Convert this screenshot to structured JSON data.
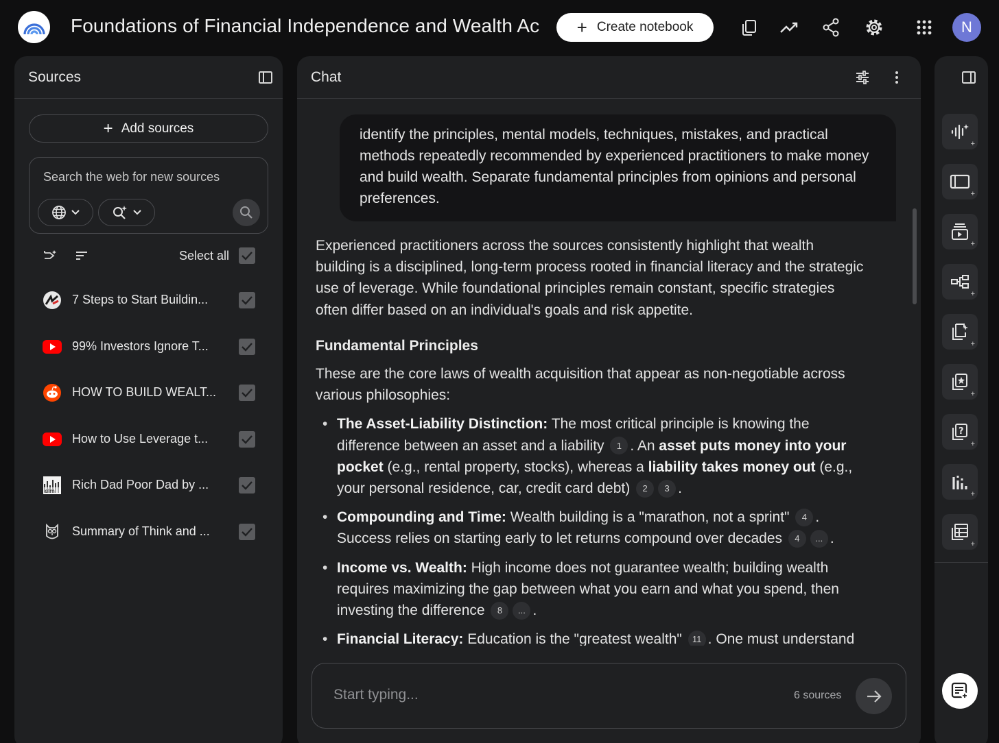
{
  "header": {
    "title": "Foundations of Financial Independence and Wealth Acquisition",
    "create_label": "Create notebook",
    "avatar_initial": "N"
  },
  "sources": {
    "title": "Sources",
    "add_label": "Add sources",
    "search_placeholder": "Search the web for new sources",
    "select_all_label": "Select all",
    "items": [
      {
        "label": "7 Steps to Start Buildin...",
        "icon": "brand-icon"
      },
      {
        "label": "99% Investors Ignore T...",
        "icon": "youtube-icon"
      },
      {
        "label": "HOW TO BUILD WEALT...",
        "icon": "reddit-icon"
      },
      {
        "label": "How to Use Leverage t...",
        "icon": "youtube-icon"
      },
      {
        "label": "Rich Dad Poor Dad by ...",
        "icon": "book-thumbnail-icon"
      },
      {
        "label": "Summary of Think and ...",
        "icon": "owl-icon"
      }
    ]
  },
  "chat": {
    "title": "Chat",
    "user_message": "identify the principles, mental models, techniques, mistakes, and practical methods repeatedly recommended by experienced practitioners to make money and build wealth. Separate fundamental principles from opinions and personal preferences.",
    "intro": "Experienced practitioners across the sources consistently highlight that wealth building is a disciplined, long-term process rooted in financial literacy and the strategic use of leverage. While foundational principles remain constant, specific strategies often differ based on an individual's goals and risk appetite.",
    "section_heading": "Fundamental Principles",
    "section_intro": "These are the core laws of wealth acquisition that appear as non-negotiable across various philosophies:",
    "bullets": {
      "b1": {
        "lead": "The Asset-Liability Distinction:",
        "t1": " The most critical principle is knowing the difference between an asset and a liability ",
        "c1": "1",
        "t2": ". An ",
        "bold2": "asset puts money into your pocket",
        "t3": " (e.g., rental property, stocks), whereas a ",
        "bold3": "liability takes money out",
        "t4": " (e.g., your personal residence, car, credit card debt) ",
        "c2": "2",
        "c3": "3",
        "t5": "."
      },
      "b2": {
        "lead": "Compounding and Time:",
        "t1": " Wealth building is a \"marathon, not a sprint\" ",
        "c1": "4",
        "t2": ". Success relies on starting early to let returns compound over decades ",
        "c2": "4",
        "c3": "...",
        "t3": "."
      },
      "b3": {
        "lead": "Income vs. Wealth:",
        "t1": " High income does not guarantee wealth; building wealth requires maximizing the gap between what you earn and what you spend, then investing the difference ",
        "c1": "8",
        "c2": "...",
        "t2": "."
      },
      "b4": {
        "lead": "Financial Literacy:",
        "t1": " Education is the \"greatest wealth\" ",
        "c1": "11",
        "t2": ". One must understand accounting, investing, markets, and law (specifically tax and corporate"
      }
    },
    "composer_placeholder": "Start typing...",
    "sources_count": "6 sources"
  },
  "studio": {
    "buttons": [
      "audio-overview-icon",
      "video-overview-icon",
      "slides-icon",
      "mind-map-icon",
      "reports-icon",
      "flashcards-icon",
      "quiz-icon",
      "infographic-icon",
      "data-table-icon"
    ]
  },
  "colors": {
    "background": "#0f0f10",
    "panel": "#1f2022",
    "accent_avatar": "#6e78d6",
    "youtube": "#ff0000",
    "reddit": "#ff4500"
  }
}
